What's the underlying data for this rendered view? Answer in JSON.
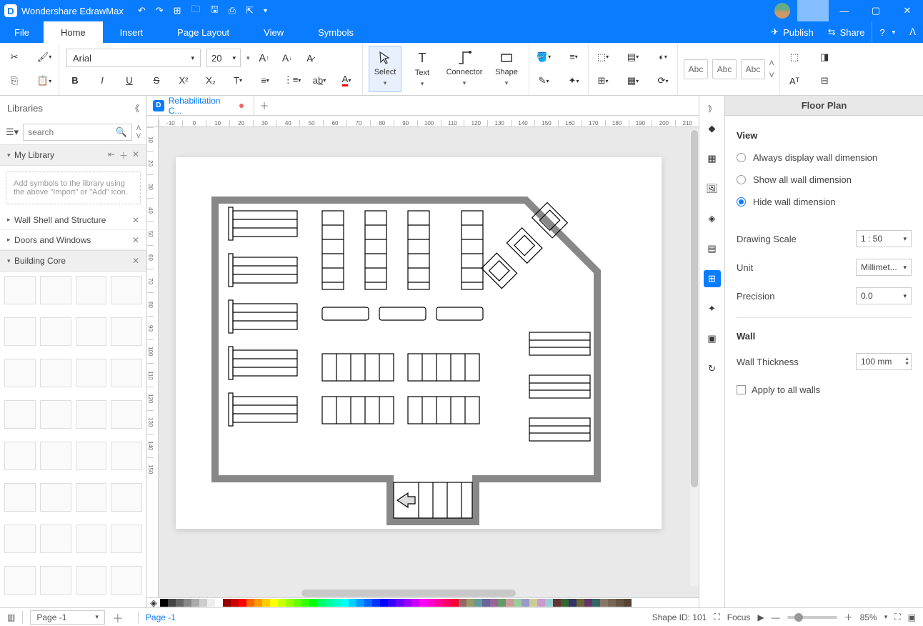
{
  "app": {
    "name": "Wondershare EdrawMax"
  },
  "menu": {
    "file": "File",
    "home": "Home",
    "insert": "Insert",
    "page_layout": "Page Layout",
    "view": "View",
    "symbols": "Symbols",
    "publish": "Publish",
    "share": "Share"
  },
  "ribbon": {
    "font": "Arial",
    "size": "20",
    "select": "Select",
    "text": "Text",
    "connector": "Connector",
    "shape": "Shape",
    "abc": "Abc"
  },
  "library": {
    "title": "Libraries",
    "search_placeholder": "search",
    "my_library": "My Library",
    "prompt": "Add symbols to the library using the above \"Import\" or \"Add\" icon.",
    "wall": "Wall Shell and Structure",
    "doors": "Doors and Windows",
    "core": "Building Core"
  },
  "tab": {
    "name": "Rehabilitation C..."
  },
  "right_panel": {
    "title": "Floor Plan",
    "view": "View",
    "opt_always": "Always display wall dimension",
    "opt_show": "Show all wall dimension",
    "opt_hide": "Hide wall dimension",
    "drawing_scale": "Drawing Scale",
    "scale_val": "1 : 50",
    "unit": "Unit",
    "unit_val": "Millimet...",
    "precision": "Precision",
    "precision_val": "0.0",
    "wall": "Wall",
    "thickness": "Wall Thickness",
    "thickness_val": "100 mm",
    "apply_all": "Apply to all walls"
  },
  "status": {
    "page_short": "Page -1",
    "page": "Page -1",
    "shape_id": "Shape ID: 101",
    "focus": "Focus",
    "zoom": "85%"
  },
  "ruler_marks": [
    "-10",
    "0",
    "10",
    "20",
    "30",
    "40",
    "50",
    "60",
    "70",
    "80",
    "90",
    "100",
    "110",
    "120",
    "130",
    "140",
    "150",
    "160",
    "170",
    "180",
    "190",
    "200",
    "210"
  ],
  "ruler_marks_v": [
    "10",
    "20",
    "30",
    "40",
    "50",
    "60",
    "70",
    "80",
    "90",
    "100",
    "110",
    "120",
    "130",
    "140",
    "150"
  ]
}
